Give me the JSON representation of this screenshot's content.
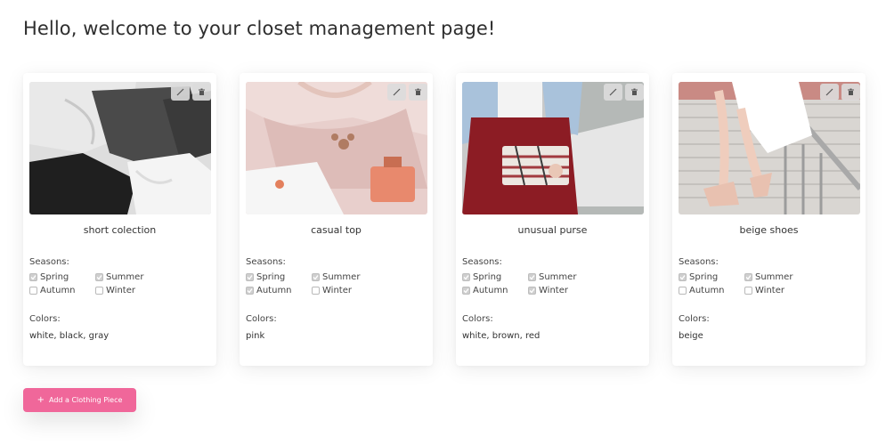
{
  "page": {
    "title": "Hello, welcome to your closet management page!"
  },
  "labels": {
    "seasons": "Seasons:",
    "colors": "Colors:",
    "spring": "Spring",
    "summer": "Summer",
    "autumn": "Autumn",
    "winter": "Winter"
  },
  "cards": [
    {
      "name": "short colection",
      "colors": "white, black, gray",
      "seasons": {
        "spring": true,
        "summer": true,
        "autumn": false,
        "winter": false
      }
    },
    {
      "name": "casual top",
      "colors": "pink",
      "seasons": {
        "spring": true,
        "summer": true,
        "autumn": true,
        "winter": false
      }
    },
    {
      "name": "unusual purse",
      "colors": "white, brown, red",
      "seasons": {
        "spring": true,
        "summer": true,
        "autumn": true,
        "winter": true
      }
    },
    {
      "name": "beige shoes",
      "colors": "beige",
      "seasons": {
        "spring": true,
        "summer": true,
        "autumn": false,
        "winter": false
      }
    }
  ],
  "actions": {
    "add_label": "Add a Clothing Piece",
    "add_icon": "plus-icon",
    "edit_icon": "pencil-icon",
    "delete_icon": "trash-icon"
  },
  "colors": {
    "accent": "#f0679a",
    "checkbox_checked": "#cfcfcf"
  }
}
